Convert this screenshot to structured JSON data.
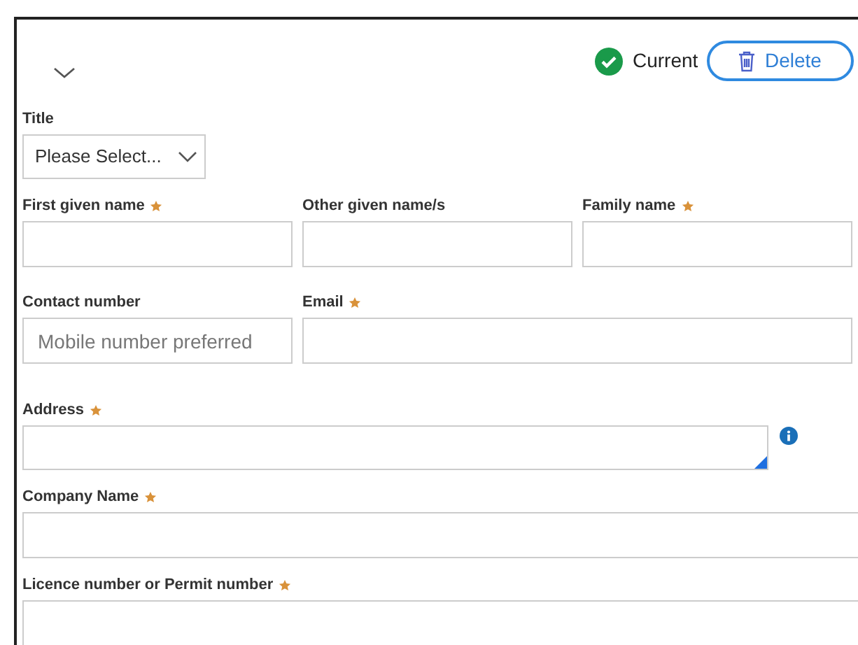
{
  "header": {
    "status": {
      "label": "Current",
      "ok": true
    },
    "delete_button": {
      "label": "Delete"
    }
  },
  "rows": [
    [
      {
        "label": "Title",
        "kind": "select",
        "value": "Please Select...",
        "required": false
      }
    ],
    [
      {
        "label": "First given name",
        "kind": "text",
        "required": true
      },
      {
        "label": "Other given name/s",
        "kind": "text",
        "required": false
      },
      {
        "label": "Family name",
        "kind": "text",
        "required": true
      }
    ],
    [
      {
        "label": "Contact number",
        "kind": "text",
        "placeholder": "Mobile number preferred",
        "required": false
      },
      {
        "label": "Email",
        "kind": "text",
        "required": true
      }
    ],
    [
      {
        "label": "Address",
        "kind": "textarea",
        "required": true,
        "info": true
      }
    ],
    [
      {
        "label": "Company Name",
        "kind": "text",
        "required": true
      }
    ],
    [
      {
        "label": "Licence number or Permit number",
        "kind": "text",
        "required": true
      }
    ]
  ]
}
